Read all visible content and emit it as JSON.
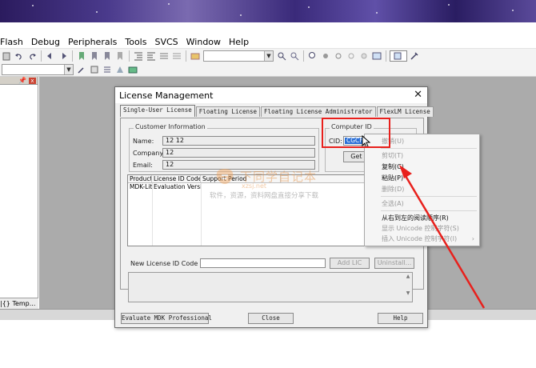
{
  "menubar": {
    "items": [
      "Flash",
      "Debug",
      "Peripherals",
      "Tools",
      "SVCS",
      "Window",
      "Help"
    ]
  },
  "left_panel": {
    "pin_glyph": "📌",
    "close_glyph": "x",
    "tab_label": "Temp..."
  },
  "dialog": {
    "title": "License Management",
    "close_glyph": "✕",
    "tabs": [
      "Single-User License",
      "Floating License",
      "Floating License Administrator",
      "FlexLM License"
    ],
    "customer_info": {
      "legend": "Customer Information",
      "name_label": "Name:",
      "name_value": "12 12",
      "company_label": "Company:",
      "company_value": "12",
      "email_label": "Email:",
      "email_value": "12"
    },
    "computer_id": {
      "legend": "Computer ID",
      "cid_label": "CID:",
      "cid_value": "CGCF",
      "get_lic_button": "Get LIC v"
    },
    "list": {
      "columns": [
        "Product",
        "License ID Code...",
        "Support Period"
      ],
      "rows": [
        {
          "product": "MDK-Lite",
          "license": "Evaluation Version",
          "support": ""
        }
      ]
    },
    "new_lic_label": "New License ID Code (LIC):",
    "add_lic_button": "Add LIC",
    "uninstall_button": "Uninstall...",
    "evaluate_button": "Evaluate MDK Professional",
    "close_button": "Close",
    "help_button": "Help"
  },
  "watermark": {
    "cn": "下同学自记本",
    "en": "xzsj.net",
    "sub": "软件，资源，资料网盘直接分享下载"
  },
  "context_menu": {
    "items": [
      {
        "label": "撤销(U)",
        "enabled": false
      },
      {
        "label": "剪切(T)",
        "enabled": false
      },
      {
        "label": "复制(C)",
        "enabled": true
      },
      {
        "label": "粘贴(P)",
        "enabled": true
      },
      {
        "label": "删除(D)",
        "enabled": false
      },
      {
        "label": "全选(A)",
        "enabled": false
      },
      {
        "label": "从右到左的阅读顺序(R)",
        "enabled": true
      },
      {
        "label": "显示 Unicode 控制字符(S)",
        "enabled": false
      },
      {
        "label": "插入 Unicode 控制字符(I)",
        "enabled": false
      }
    ],
    "submenu_glyph": "›"
  },
  "colors": {
    "annotation_red": "#e8201c",
    "selection_blue": "#2a6fd6",
    "workspace_gray": "#ababab"
  }
}
